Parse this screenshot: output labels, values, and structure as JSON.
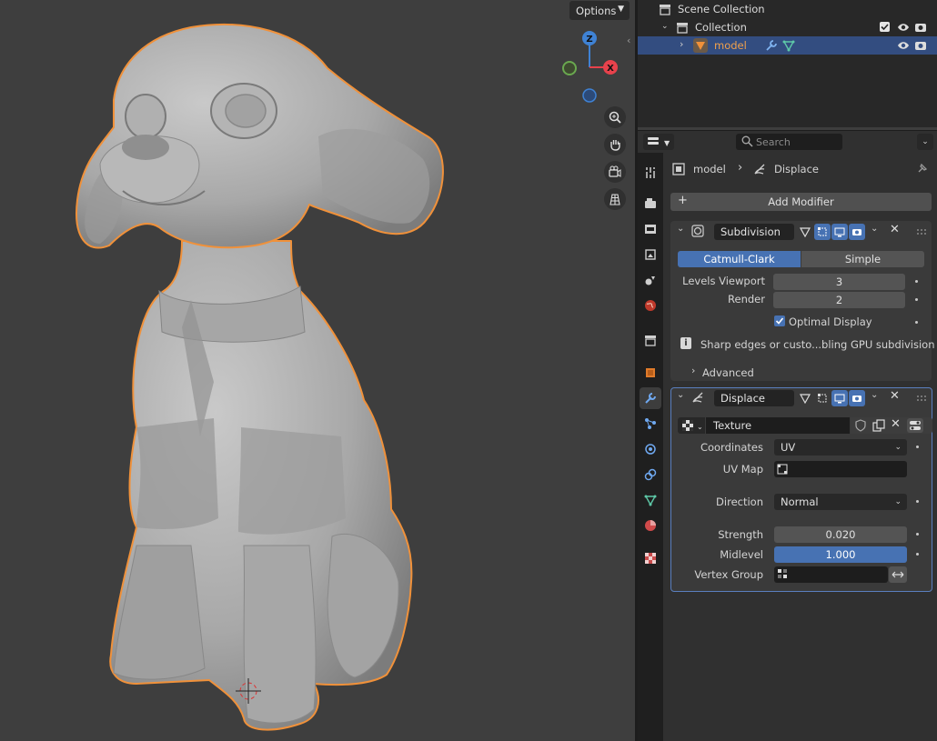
{
  "viewport": {
    "options_label": "Options",
    "gizmo": {
      "z": "Z",
      "x": "X"
    }
  },
  "outliner": {
    "rows": [
      {
        "label": "Scene Collection"
      },
      {
        "label": "Collection"
      },
      {
        "label": "model"
      }
    ]
  },
  "properties": {
    "search_placeholder": "Search",
    "breadcrumb": {
      "object": "model",
      "modifier": "Displace"
    },
    "add_modifier_label": "Add Modifier",
    "subdivision": {
      "name": "Subdivision",
      "mode_options": [
        "Catmull-Clark",
        "Simple"
      ],
      "mode_selected": "Catmull-Clark",
      "levels_viewport_label": "Levels Viewport",
      "levels_viewport_value": "3",
      "render_label": "Render",
      "render_value": "2",
      "optimal_display_label": "Optimal Display",
      "optimal_display_checked": true,
      "info_text": "Sharp edges or custo...bling GPU subdivision",
      "advanced_label": "Advanced"
    },
    "displace": {
      "name": "Displace",
      "texture_label": "Texture",
      "coordinates_label": "Coordinates",
      "coordinates_value": "UV",
      "uv_map_label": "UV Map",
      "uv_map_value": "",
      "direction_label": "Direction",
      "direction_value": "Normal",
      "strength_label": "Strength",
      "strength_value": "0.020",
      "midlevel_label": "Midlevel",
      "midlevel_value": "1.000",
      "vertex_group_label": "Vertex Group",
      "vertex_group_value": ""
    }
  },
  "colors": {
    "selection_outline": "#f0913a",
    "accent_blue": "#4772b3",
    "axis_x": "#e8424c",
    "axis_y": "#6aa84f",
    "axis_z": "#3f82d4"
  }
}
